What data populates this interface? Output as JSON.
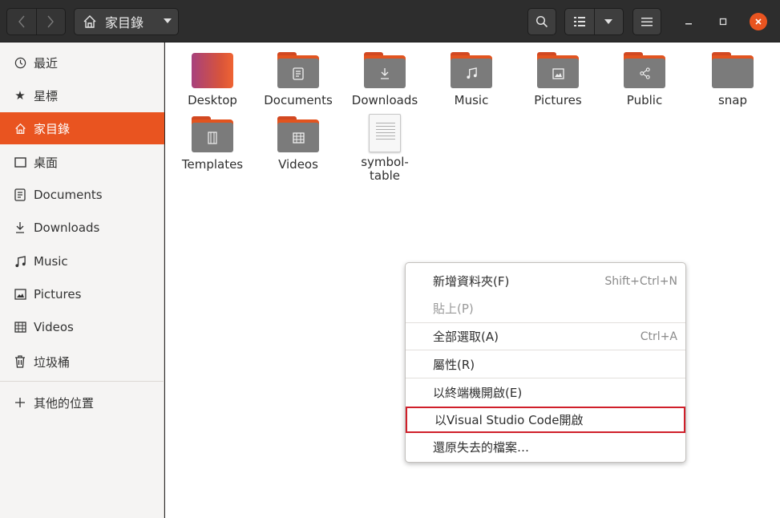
{
  "header": {
    "path_label": "家目錄",
    "icons": {
      "back": "chevron-left-icon",
      "forward": "chevron-right-icon",
      "home": "home-icon",
      "search": "search-icon",
      "view": "list-view-icon",
      "menu": "hamburger-icon"
    }
  },
  "sidebar": {
    "items": [
      {
        "label": "最近",
        "icon": "clock-icon"
      },
      {
        "label": "星標",
        "icon": "star-icon"
      },
      {
        "label": "家目錄",
        "icon": "home-icon",
        "active": true
      },
      {
        "label": "桌面",
        "icon": "desktop-icon"
      },
      {
        "label": "Documents",
        "icon": "document-icon"
      },
      {
        "label": "Downloads",
        "icon": "download-icon"
      },
      {
        "label": "Music",
        "icon": "music-icon"
      },
      {
        "label": "Pictures",
        "icon": "picture-icon"
      },
      {
        "label": "Videos",
        "icon": "video-icon"
      },
      {
        "label": "垃圾桶",
        "icon": "trash-icon"
      },
      {
        "label": "其他的位置",
        "icon": "plus-icon"
      }
    ]
  },
  "files": [
    {
      "name": "Desktop",
      "icon": "desktop-folder-icon"
    },
    {
      "name": "Documents",
      "icon": "documents-folder-icon"
    },
    {
      "name": "Downloads",
      "icon": "downloads-folder-icon"
    },
    {
      "name": "Music",
      "icon": "music-folder-icon"
    },
    {
      "name": "Pictures",
      "icon": "pictures-folder-icon"
    },
    {
      "name": "Public",
      "icon": "public-folder-icon"
    },
    {
      "name": "snap",
      "icon": "folder-icon"
    },
    {
      "name": "Templates",
      "icon": "templates-folder-icon"
    },
    {
      "name": "Videos",
      "icon": "videos-folder-icon"
    },
    {
      "name": "symbol-table",
      "icon": "text-file-icon"
    }
  ],
  "context_menu": {
    "items": [
      {
        "label": "新增資料夾(F)",
        "shortcut": "Shift+Ctrl+N"
      },
      {
        "label": "貼上(P)",
        "shortcut": "",
        "disabled": true
      },
      {
        "label": "全部選取(A)",
        "shortcut": "Ctrl+A"
      },
      {
        "label": "屬性(R)",
        "shortcut": ""
      },
      {
        "label": "以終端機開啟(E)",
        "shortcut": ""
      },
      {
        "label": "以Visual Studio Code開啟",
        "shortcut": "",
        "highlighted": true
      },
      {
        "label": "還原失去的檔案…",
        "shortcut": ""
      }
    ]
  },
  "colors": {
    "accent": "#e95420",
    "header_bg": "#2d2d2d",
    "sidebar_bg": "#f5f4f3",
    "highlight_border": "#d01f2a"
  }
}
